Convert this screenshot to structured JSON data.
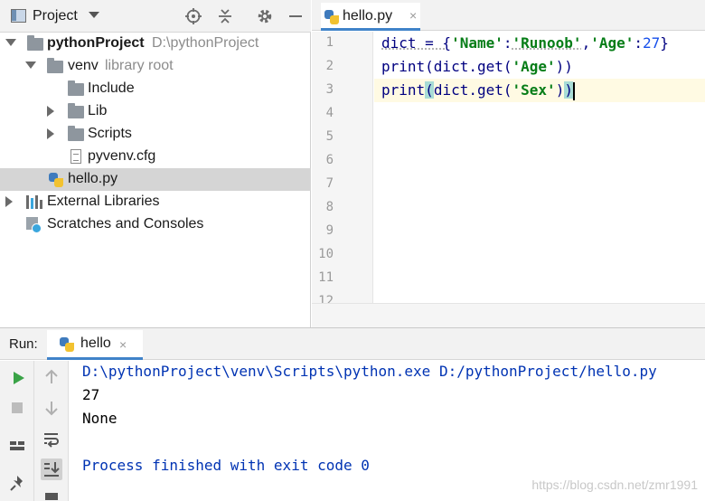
{
  "project_pane": {
    "title": "Project",
    "tree": [
      {
        "label": "pythonProject",
        "hint": "D:\\pythonProject",
        "icon": "folder-icon"
      },
      {
        "label": "venv",
        "hint": "library root",
        "icon": "folder-icon"
      },
      {
        "label": "Include",
        "icon": "folder-icon"
      },
      {
        "label": "Lib",
        "icon": "folder-icon"
      },
      {
        "label": "Scripts",
        "icon": "folder-icon"
      },
      {
        "label": "pyvenv.cfg",
        "icon": "config-file-icon"
      },
      {
        "label": "hello.py",
        "icon": "python-file-icon",
        "selected": true
      },
      {
        "label": "External Libraries",
        "icon": "library-icon"
      },
      {
        "label": "Scratches and Consoles",
        "icon": "scratches-icon"
      }
    ]
  },
  "editor": {
    "tab": {
      "label": "hello.py",
      "close": "×"
    },
    "line_numbers": [
      "1",
      "2",
      "3",
      "4",
      "5",
      "6",
      "7",
      "8",
      "9",
      "10",
      "11",
      "12"
    ],
    "code": {
      "line1": {
        "a": "dict = {",
        "s1": "'Name'",
        "b": ":",
        "s2": "'Runoob'",
        "c": ",",
        "s3": "'Age'",
        "d": ":",
        "n1": "27",
        "e": "}"
      },
      "line2": {
        "a": "print(dict.get(",
        "s1": "'Age'",
        "b": "))"
      },
      "line3": {
        "a": "print",
        "p1": "(",
        "b": "dict.get(",
        "s1": "'Sex'",
        "c": ")",
        "p2": ")"
      }
    },
    "current_line": 3
  },
  "run": {
    "title": "Run:",
    "tab": {
      "label": "hello",
      "close": "×"
    },
    "console": {
      "command": "D:\\pythonProject\\venv\\Scripts\\python.exe D:/pythonProject/hello.py",
      "output": [
        "27",
        "None"
      ],
      "exit": "Process finished with exit code 0"
    }
  },
  "watermark": "https://blog.csdn.net/zmr1991",
  "colors": {
    "selection": "#d5d5d5",
    "current_line": "#fffae3",
    "string": "#067d17",
    "number": "#1750eb",
    "bracket_match": "#a8dcd6",
    "tab_underline": "#4083c9"
  }
}
